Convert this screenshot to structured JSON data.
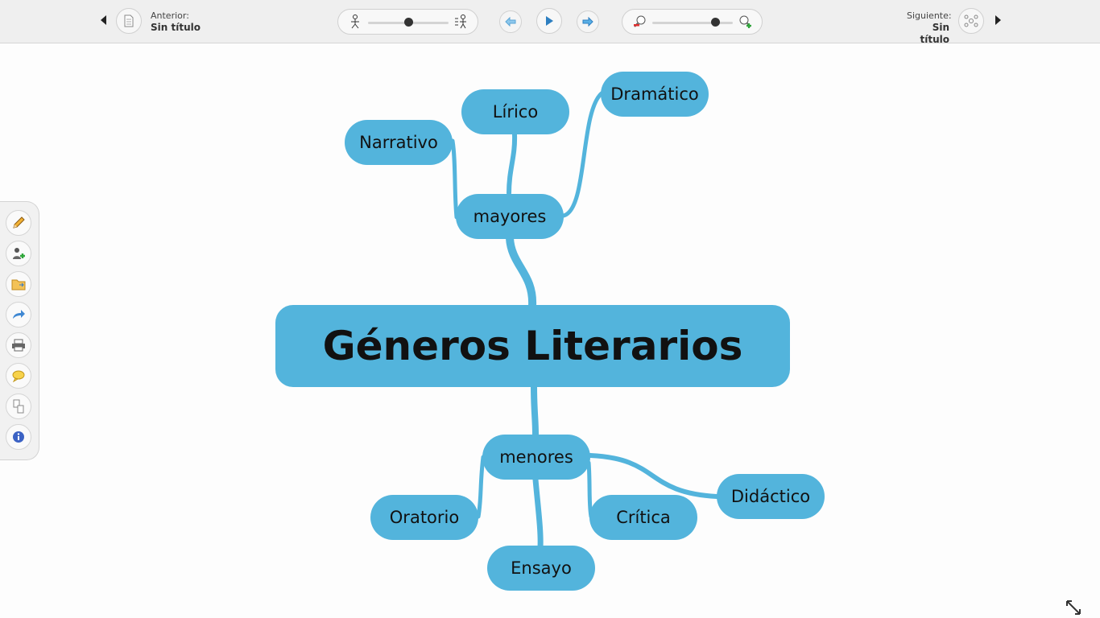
{
  "toolbar": {
    "previous": {
      "label": "Anterior:",
      "title": "Sin título"
    },
    "next": {
      "label": "Siguiente:",
      "title": "Sin título"
    }
  },
  "mindmap": {
    "root": "Géneros Literarios",
    "branches": [
      {
        "label": "mayores",
        "children": [
          "Narrativo",
          "Lírico",
          "Dramático"
        ]
      },
      {
        "label": "menores",
        "children": [
          "Oratorio",
          "Ensayo",
          "Crítica",
          "Didáctico"
        ]
      }
    ]
  },
  "sidebar_tools": [
    "pencil-icon",
    "add-user-icon",
    "folder-icon",
    "share-icon",
    "print-icon",
    "comment-icon",
    "document-tree-icon",
    "info-icon"
  ],
  "colors": {
    "node": "#53b4dc",
    "connector": "#53b4dc",
    "toolbar": "#efefef"
  }
}
